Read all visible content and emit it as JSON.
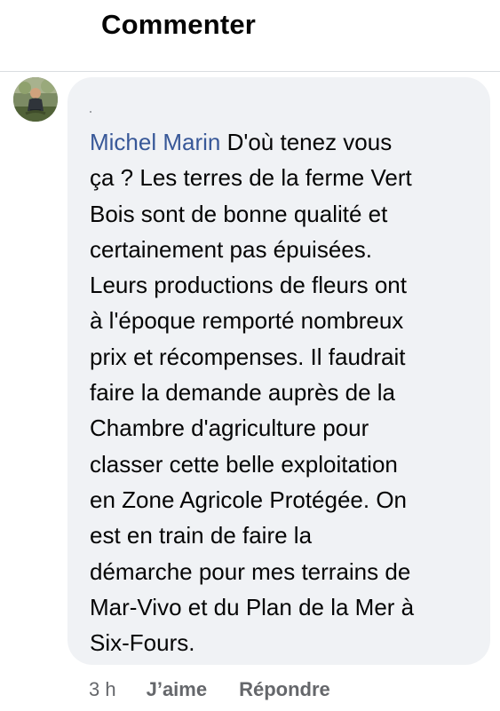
{
  "header": {
    "title": "Commenter"
  },
  "comment": {
    "author": "Michel Marin",
    "text": " D'où tenez vous\nça ? Les terres de la ferme Vert\nBois sont de bonne qualité et\ncertainement pas épuisées.\nLeurs productions de fleurs ont\nà l'époque remporté nombreux\nprix et récompenses. Il faudrait\nfaire la demande  auprès de la\nChambre d'agriculture pour\nclasser cette belle exploitation\nen Zone Agricole Protégée. On\nest en train de faire la\ndémarche pour mes terrains de\nMar-Vivo et du Plan de la Mer à\nSix-Fours.",
    "timestamp": "3 h",
    "like_label": "J’aime",
    "reply_label": "Répondre"
  },
  "colors": {
    "author_link": "#385898",
    "bubble_background": "#f0f2f5",
    "secondary_text": "#65676b"
  },
  "icons": {
    "avatar": "profile-photo"
  }
}
